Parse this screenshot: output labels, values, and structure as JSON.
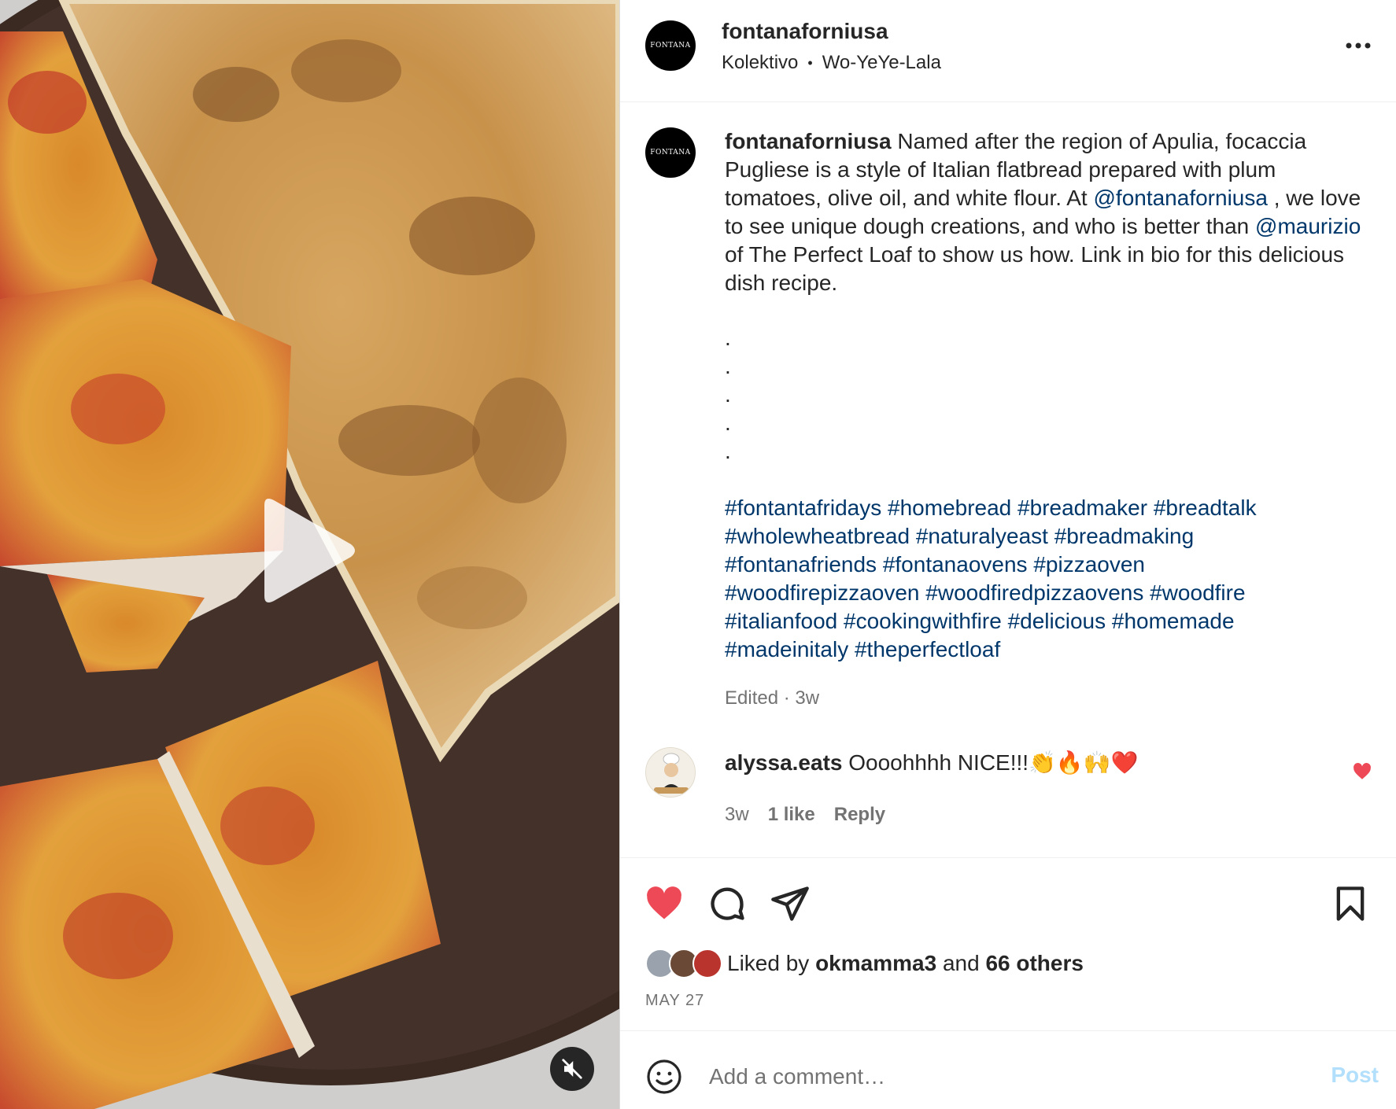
{
  "post": {
    "author": "fontanaforniusa",
    "avatar_logo_text": "FONTANA",
    "audio": {
      "artist": "Kolektivo",
      "separator": "•",
      "track": "Wo-YeYe-Lala"
    },
    "caption": {
      "text_1": " Named after the region of Apulia, focaccia Pugliese is a style of Italian flatbread prepared with plum tomatoes, olive oil, and white flour. At ",
      "mention_1": "@fontanaforniusa",
      "text_2": " , we love to see unique dough creations, and who is better than ",
      "mention_2": "@maurizio",
      "text_3": " of The Perfect Loaf to show us how. Link in bio for this delicious dish recipe."
    },
    "dots": [
      ".",
      ".",
      ".",
      ".",
      "."
    ],
    "hashtags": [
      "#fontantafridays",
      "#homebread",
      "#breadmaker",
      "#breadtalk",
      "#wholewheatbread",
      "#naturalyeast",
      "#breadmaking",
      "#fontanafriends",
      "#fontanaovens",
      "#pizzaoven",
      "#woodfirepizzaoven",
      "#woodfiredpizzaovens",
      "#woodfire",
      "#italianfood",
      "#cookingwithfire",
      "#delicious",
      "#homemade",
      "#madeinitaly",
      "#theperfectloaf"
    ],
    "meta": "Edited · 3w"
  },
  "comment": {
    "username": "alyssa.eats",
    "text": " Oooohhhh NICE!!!👏🔥🙌❤️",
    "age": "3w",
    "likes": "1 like",
    "reply": "Reply"
  },
  "likes": {
    "prefix": "Liked by ",
    "user": "okmamma3",
    "middle": " and ",
    "others": "66 others"
  },
  "date": "MAY 27",
  "add_comment": {
    "placeholder": "Add a comment…",
    "post_label": "Post"
  },
  "icons": {
    "more": "more-horizontal-icon",
    "play": "play-icon",
    "mute": "muted-speaker-icon",
    "like": "heart-filled-icon",
    "comment": "comment-bubble-icon",
    "share": "paper-plane-icon",
    "save": "bookmark-icon",
    "emoji": "smiley-icon"
  },
  "colors": {
    "liked_red": "#ed4956",
    "link_blue": "#00376b",
    "post_button": "#b2dffc",
    "muted_gray": "#737373"
  }
}
